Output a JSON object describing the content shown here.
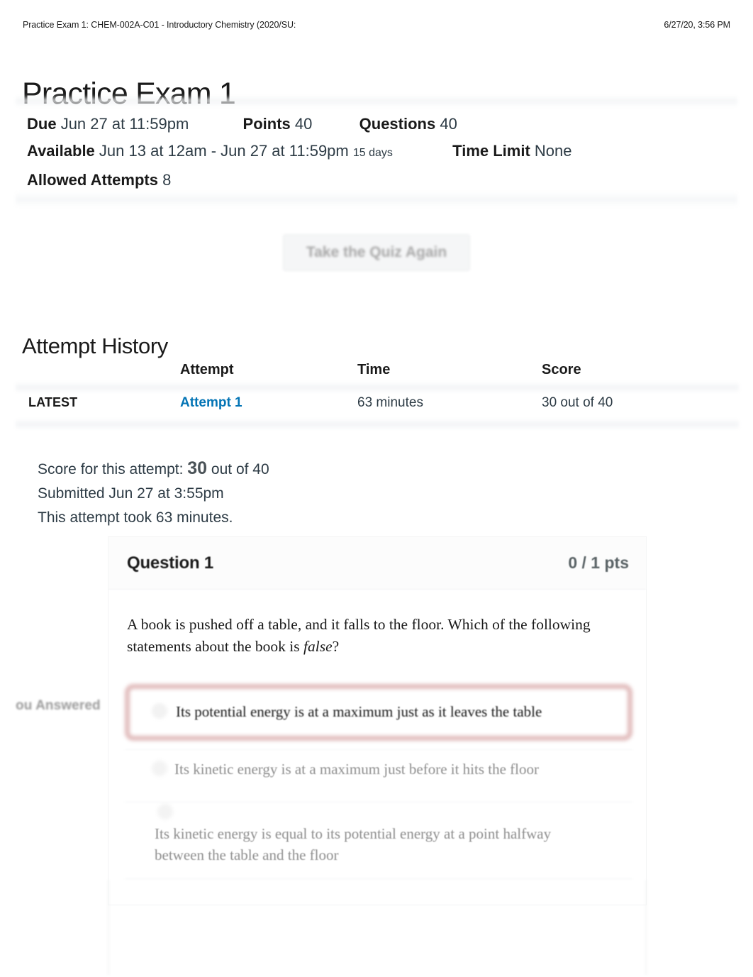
{
  "print_header": {
    "left": "Practice Exam 1: CHEM-002A-C01 - Introductory Chemistry (2020/SU:",
    "right": "6/27/20, 3:56 PM"
  },
  "page_title": "Practice Exam 1",
  "quiz_meta": {
    "due_label": "Due",
    "due_value": "Jun 27 at 11:59pm",
    "points_label": "Points",
    "points_value": "40",
    "questions_label": "Questions",
    "questions_value": "40",
    "available_label": "Available",
    "available_value": "Jun 13 at 12am - Jun 27 at 11:59pm",
    "available_duration": "15 days",
    "time_limit_label": "Time Limit",
    "time_limit_value": "None",
    "allowed_attempts_label": "Allowed Attempts",
    "allowed_attempts_value": "8"
  },
  "take_quiz_button": "Take the Quiz Again",
  "attempt_history": {
    "heading": "Attempt History",
    "columns": [
      "",
      "Attempt",
      "Time",
      "Score"
    ],
    "rows": [
      {
        "latest": "LATEST",
        "attempt": "Attempt 1",
        "time": "63 minutes",
        "score": "30 out of 40"
      }
    ]
  },
  "attempt_summary": {
    "score_prefix": "Score for this attempt:",
    "score_value": "30",
    "score_suffix": "out of 40",
    "submitted": "Submitted Jun 27 at 3:55pm",
    "duration": "This attempt took 63 minutes."
  },
  "question": {
    "name": "Question 1",
    "points": "0 / 1 pts",
    "text_before_italic": "A book is pushed off a table, and it falls to the floor. Which of the following statements about the book is ",
    "text_italic": "false",
    "text_after_italic": "?",
    "you_answered_label": "ou Answered",
    "answers": [
      {
        "text": "Its potential energy is at a maximum just as it leaves the table",
        "state": "selected-incorrect"
      },
      {
        "text": "Its kinetic energy is at a maximum just before it hits the floor",
        "state": "unselected"
      },
      {
        "text": "Its kinetic energy is equal to its potential energy at a point halfway between the table and the floor",
        "state": "unselected"
      }
    ]
  },
  "colors": {
    "link": "#0374b5",
    "incorrect_border": "#e0b9b9",
    "text": "#2d3b45",
    "muted": "#8d8d8d"
  }
}
